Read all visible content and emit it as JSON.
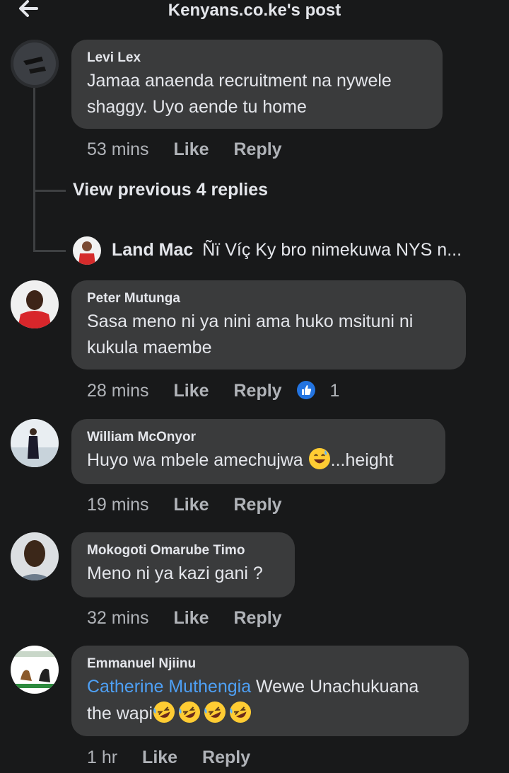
{
  "header": {
    "title": "Kenyans.co.ke's post"
  },
  "comments": [
    {
      "author": "Levi Lex",
      "text_lines": [
        "Jamaa anaenda recruitment na nywele",
        "shaggy. Uyo aende tu home"
      ],
      "time": "53 mins",
      "like": "Like",
      "reply": "Reply"
    },
    {
      "author": "Peter Mutunga",
      "text_lines": [
        "Sasa meno ni ya nini ama huko msituni ni",
        "kukula maembe"
      ],
      "time": "28 mins",
      "like": "Like",
      "reply": "Reply",
      "reaction_count": "1"
    },
    {
      "author": "William McOnyor",
      "text_before_emoji": "Huyo wa mbele amechujwa ",
      "text_after_emoji": "...height",
      "time": "19 mins",
      "like": "Like",
      "reply": "Reply"
    },
    {
      "author": "Mokogoti Omarube Timo",
      "text_lines": [
        "Meno ni ya kazi gani ?"
      ],
      "time": "32 mins",
      "like": "Like",
      "reply": "Reply"
    },
    {
      "author": "Emmanuel Njiinu",
      "mention": "Catherine Muthengia",
      "text_after_mention": " Wewe Unachukuana",
      "line2": "the wapi",
      "time": "1 hr",
      "like": "Like",
      "reply": "Reply"
    }
  ],
  "thread": {
    "view_previous": "View previous 4 replies",
    "reply_author": "Land Mac",
    "reply_preview": "Ñï Víç Ky bro nimekuwa NYS n..."
  },
  "icons": {
    "back": "back-arrow-icon",
    "like_reaction": "thumbs-up-icon",
    "laugh_sweat": "grinning-sweat-emoji",
    "rofl": "rolling-laughing-emoji"
  },
  "colors": {
    "background": "#18191a",
    "bubble": "#3a3b3c",
    "text": "#e4e6eb",
    "muted": "#b0b3b8",
    "mention": "#4ea0f5",
    "like_blue": "#2374e1"
  }
}
